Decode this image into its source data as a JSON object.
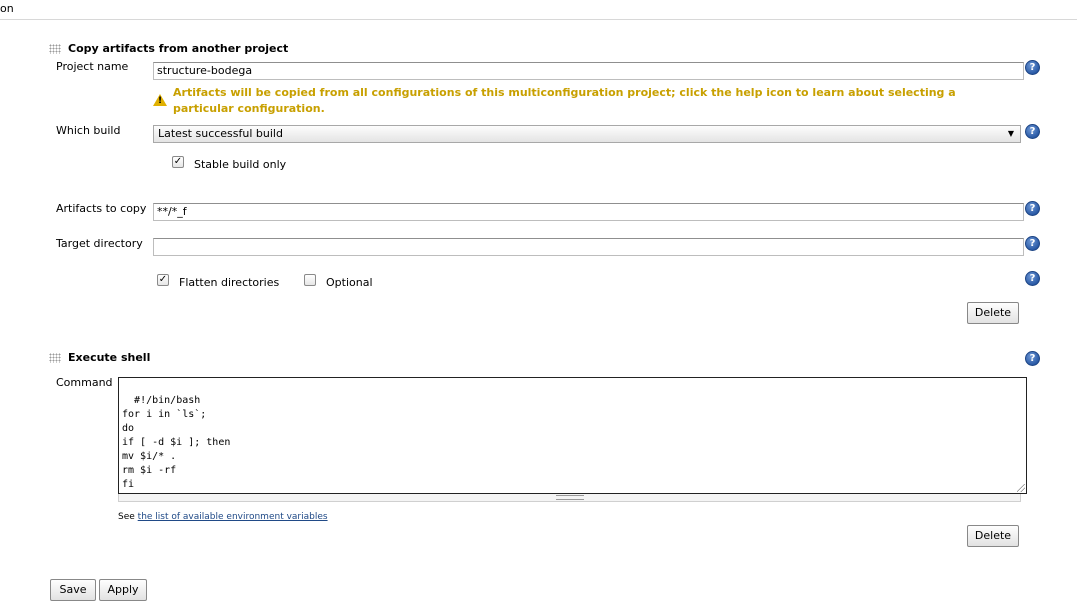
{
  "header": {
    "cut_title": "on"
  },
  "copy_artifacts": {
    "title": "Copy artifacts from another project",
    "project_name_label": "Project name",
    "project_name_value": "structure-bodega",
    "warning": "Artifacts will be copied from all configurations of this multiconfiguration project; click the help icon to learn about selecting a particular configuration.",
    "warning_line1": "Artifacts will be copied from all configurations of this multiconfiguration project; click the help icon to learn about selecting a",
    "warning_line2": "particular configuration.",
    "which_build_label": "Which build",
    "which_build_value": "Latest successful build",
    "stable_build_label": "Stable build only",
    "stable_build_checked": true,
    "artifacts_label": "Artifacts to copy",
    "artifacts_value": "**/*_f",
    "target_dir_label": "Target directory",
    "target_dir_value": "",
    "flatten_label": "Flatten directories",
    "flatten_checked": true,
    "optional_label": "Optional",
    "optional_checked": false,
    "delete_label": "Delete"
  },
  "execute_shell": {
    "title": "Execute shell",
    "command_label": "Command",
    "command_text": "#!/bin/bash\nfor i in `ls`;\ndo\nif [ -d $i ]; then\nmv $i/* .\nrm $i -rf\nfi\ndone",
    "see_prefix": "See",
    "env_link": "the list of available environment variables",
    "delete_label": "Delete"
  },
  "footer": {
    "save_label": "Save",
    "apply_label": "Apply"
  },
  "icons": {
    "help": "help-icon",
    "warning": "warning-icon",
    "drag": "drag-handle-icon"
  },
  "colors": {
    "warning_text": "#c8a000",
    "help_blue": "#2a5aa6",
    "link": "#204a87"
  }
}
